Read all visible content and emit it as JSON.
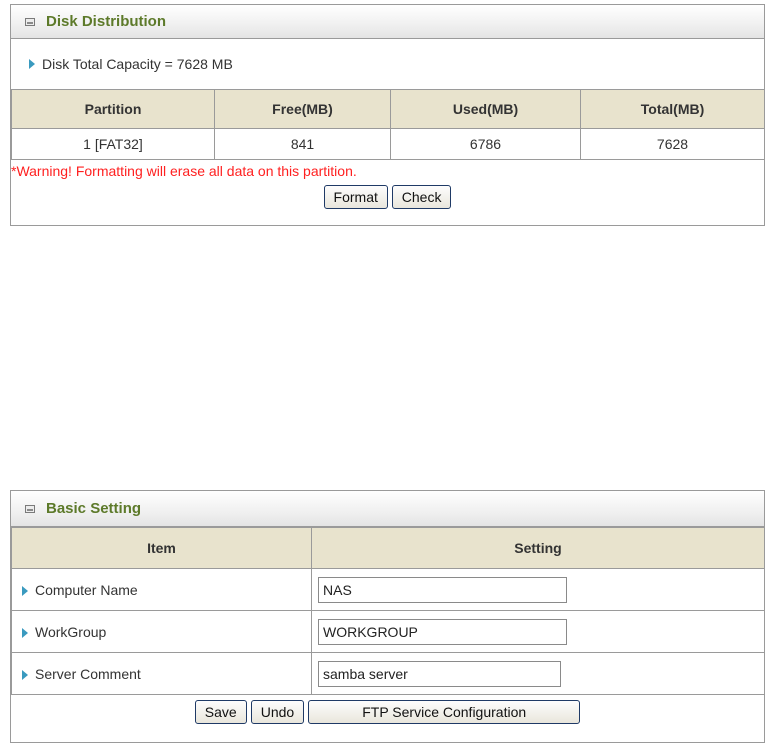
{
  "disk_panel": {
    "title": "Disk Distribution",
    "capacity_text": "Disk Total Capacity = 7628 MB",
    "columns": [
      "Partition",
      "Free(MB)",
      "Used(MB)",
      "Total(MB)"
    ],
    "rows": [
      [
        "1 [FAT32]",
        "841",
        "6786",
        "7628"
      ]
    ],
    "warning": "*Warning! Formatting will erase all data on this partition.",
    "format_label": "Format",
    "check_label": "Check"
  },
  "basic_panel": {
    "title": "Basic Setting",
    "col_item": "Item",
    "col_setting": "Setting",
    "computer_name_label": "Computer Name",
    "computer_name_value": "NAS",
    "workgroup_label": "WorkGroup",
    "workgroup_value": "WORKGROUP",
    "server_comment_label": "Server Comment",
    "server_comment_value": "samba server",
    "save_label": "Save",
    "undo_label": "Undo",
    "ftp_label": "FTP Service Configuration"
  },
  "colors": {
    "title_green": "#5d7a2a",
    "header_bg": "#e8e3cd",
    "warning_red": "#ff2020",
    "bullet_blue": "#3a9abf"
  }
}
